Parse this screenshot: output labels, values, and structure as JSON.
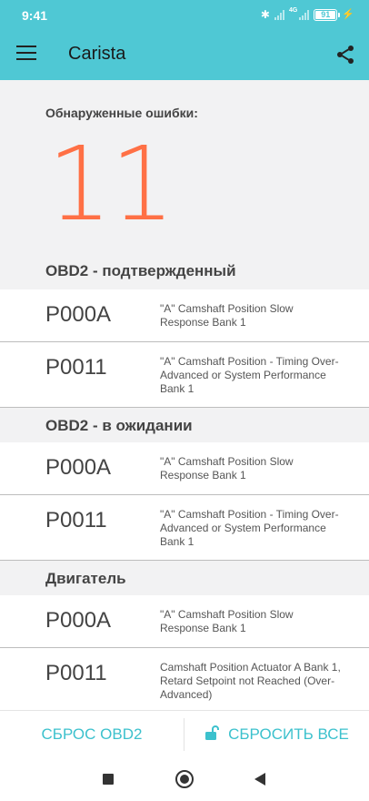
{
  "status_bar": {
    "time": "9:41",
    "network": "4G",
    "battery": "91"
  },
  "app_bar": {
    "title": "Carista"
  },
  "summary": {
    "caption": "Обнаруженные ошибки:",
    "count": "11"
  },
  "sections": [
    {
      "title": "OBD2 - подтвержденный",
      "rows": [
        {
          "code": "P000A",
          "description": "\"A\" Camshaft Position Slow Response Bank 1"
        },
        {
          "code": "P0011",
          "description": "\"A\" Camshaft Position - Timing Over-Advanced or System Performance Bank 1"
        }
      ]
    },
    {
      "title": "OBD2 - в ожидании",
      "rows": [
        {
          "code": "P000A",
          "description": "\"A\" Camshaft Position Slow Response Bank 1"
        },
        {
          "code": "P0011",
          "description": "\"A\" Camshaft Position - Timing Over-Advanced or System Performance Bank 1"
        }
      ]
    },
    {
      "title": "Двигатель",
      "rows": [
        {
          "code": "P000A",
          "description": "\"A\" Camshaft Position Slow Response Bank 1"
        },
        {
          "code": "P0011",
          "description": "Camshaft Position Actuator A Bank 1, Retard Setpoint not Reached (Over-Advanced)"
        }
      ]
    }
  ],
  "actions": {
    "reset_obd2": "СБРОС OBD2",
    "reset_all": "СБРОСИТЬ ВСЕ"
  },
  "colors": {
    "accent": "#4fc8d4",
    "count": "#ff7045",
    "action_text": "#3cc1cd"
  },
  "icons": {
    "menu": "hamburger-menu-icon",
    "share": "share-icon",
    "reset_all": "unlock-icon"
  }
}
